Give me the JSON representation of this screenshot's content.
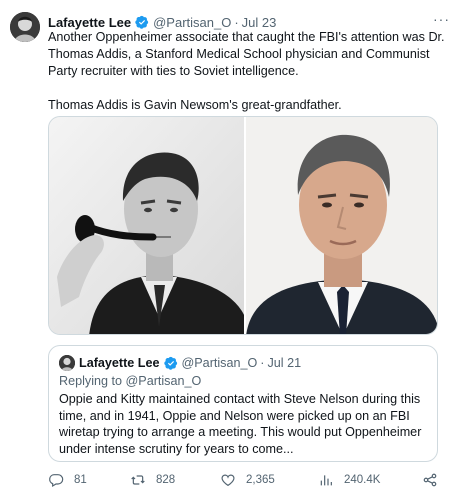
{
  "author": {
    "name": "Lafayette Lee",
    "handle": "@Partisan_O",
    "separator": "·",
    "date": "Jul 23"
  },
  "more_label": "···",
  "body": {
    "paragraph_1": "Another Oppenheimer associate that caught the FBI's attention was Dr. Thomas Addis, a Stanford Medical School physician and Communist Party recruiter with ties to Soviet intelligence.",
    "paragraph_2": "Thomas Addis is Gavin Newsom's great-grandfather."
  },
  "quote": {
    "name": "Lafayette Lee",
    "handle": "@Partisan_O",
    "separator": "·",
    "date": "Jul 21",
    "replying_to": "Replying to @Partisan_O",
    "text": "Oppie and Kitty maintained contact with Steve Nelson during this time, and in 1941, Oppie and Nelson were picked up on an FBI wiretap trying to arrange a meeting. This would put Oppenheimer under intense scrutiny for years to come..."
  },
  "actions": {
    "replies": "81",
    "reposts": "828",
    "likes": "2,365",
    "views": "240.4K"
  },
  "colors": {
    "verified": "#1d9bf0",
    "muted_text": "#536471",
    "border": "#cfd9de"
  }
}
